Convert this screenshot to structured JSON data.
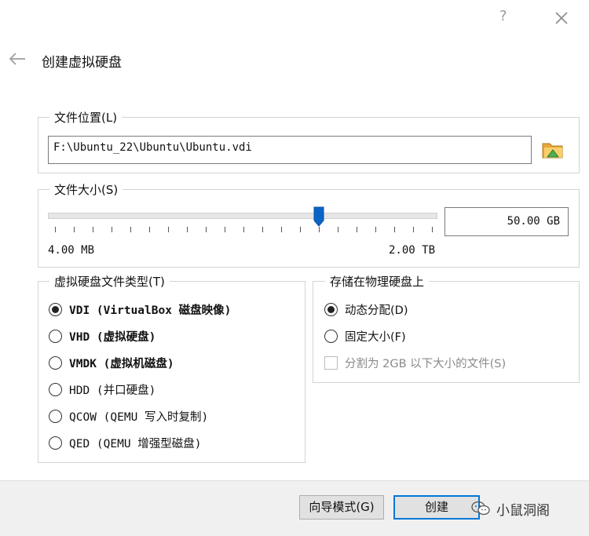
{
  "titlebar": {
    "help": "?",
    "close_icon": "close-icon"
  },
  "dialog": {
    "title": "创建虚拟硬盘",
    "back_icon": "back-arrow-icon"
  },
  "file_location": {
    "legend": "文件位置(L)",
    "path": "F:\\Ubuntu_22\\Ubuntu\\Ubuntu.vdi",
    "browse_icon": "folder-icon"
  },
  "file_size": {
    "legend": "文件大小(S)",
    "value": "50.00 GB",
    "min_label": "4.00 MB",
    "max_label": "2.00 TB",
    "slider_fraction": 0.7
  },
  "disk_type": {
    "legend": "虚拟硬盘文件类型(T)",
    "options": [
      {
        "label": "VDI (VirtualBox 磁盘映像)",
        "selected": true
      },
      {
        "label": "VHD (虚拟硬盘)",
        "selected": false
      },
      {
        "label": "VMDK (虚拟机磁盘)",
        "selected": false
      },
      {
        "label": "HDD (并口硬盘)",
        "selected": false
      },
      {
        "label": "QCOW (QEMU 写入时复制)",
        "selected": false
      },
      {
        "label": "QED (QEMU 增强型磁盘)",
        "selected": false
      }
    ]
  },
  "storage": {
    "legend": "存储在物理硬盘上",
    "options": [
      {
        "label": "动态分配(D)",
        "selected": true
      },
      {
        "label": "固定大小(F)",
        "selected": false
      }
    ],
    "split_checkbox": {
      "label": "分割为 2GB 以下大小的文件(S)",
      "checked": false,
      "enabled": false
    }
  },
  "footer": {
    "wizard_button": "向导模式(G)",
    "create_button": "创建",
    "watermark": "小鼠洞阁"
  }
}
